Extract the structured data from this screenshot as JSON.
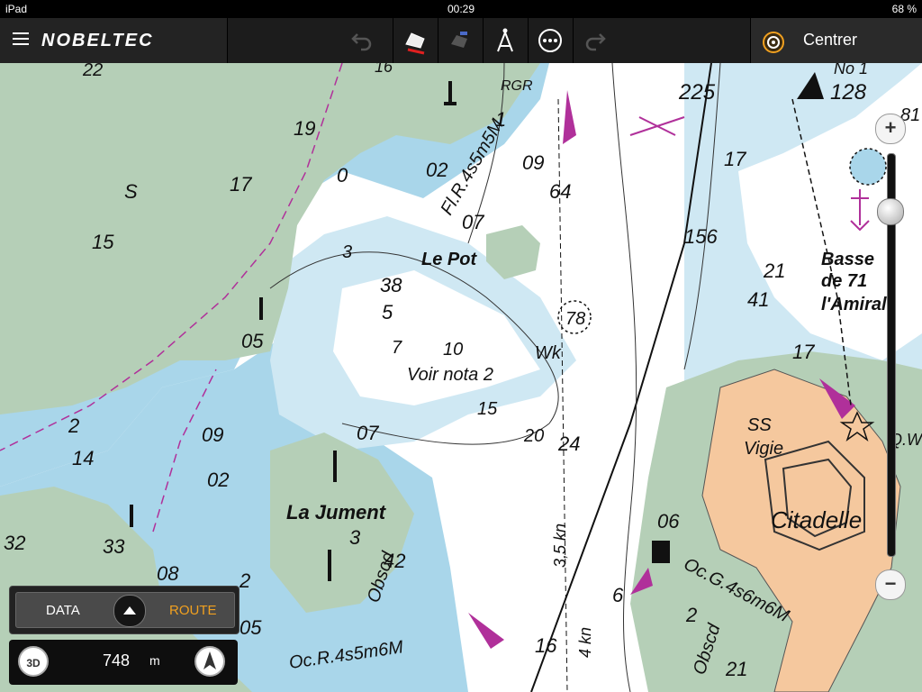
{
  "status_bar": {
    "device": "iPad",
    "time": "00:29",
    "battery": "68 %"
  },
  "app": {
    "brand": "NOBELTEC",
    "center_label": "Centrer"
  },
  "toolbar_icons": [
    "undo-icon",
    "boat-icon",
    "route-icon",
    "measure-compass-icon",
    "more-icon",
    "redo-icon"
  ],
  "map_labels": {
    "le_pot": "Le Pot",
    "la_jument": "La Jument",
    "voir_nota": "Voir nota 2",
    "citadelle": "Citadelle",
    "ss_vigie": "SS",
    "vigie": "Vigie",
    "basse": "Basse",
    "de": "de 71",
    "amiral": "l'Amiral",
    "fl_r": "Fl.R.4s5m5M",
    "oc_r": "Oc.R.4s5m6M",
    "oc_g": "Oc.G.4s6m6M",
    "obscd1": "Obscd",
    "obscd2": "Obscd",
    "rgr": "RGR",
    "wk": "Wk",
    "knots1": "3,5 kn",
    "knots2": "4 kn",
    "no1": "No 1",
    "s": "S",
    "q": "Q.W"
  },
  "depth_soundings": [
    "22",
    "19",
    "17",
    "15",
    "05",
    "02",
    "07",
    "09",
    "64",
    "38",
    "5",
    "7",
    "10",
    "15",
    "20",
    "24",
    "225",
    "17",
    "156",
    "21",
    "41",
    "17",
    "128",
    "81",
    "78",
    "2",
    "14",
    "09",
    "07",
    "02",
    "33",
    "32",
    "08",
    "2",
    "05",
    "3",
    "42",
    "06",
    "6",
    "2",
    "16",
    "21",
    "1",
    "3",
    "0",
    "16"
  ],
  "controls": {
    "data_label": "DATA",
    "route_label": "ROUTE",
    "mode_3d": "3D",
    "scale_value": "748",
    "scale_unit": "m"
  },
  "colors": {
    "land": "#b5cfb7",
    "shallow": "#a9d6ea",
    "medium": "#cfe8f3",
    "deep": "#ffffff",
    "citadel": "#f5c89e",
    "magenta": "#b0309a",
    "accent": "#f0a020"
  }
}
